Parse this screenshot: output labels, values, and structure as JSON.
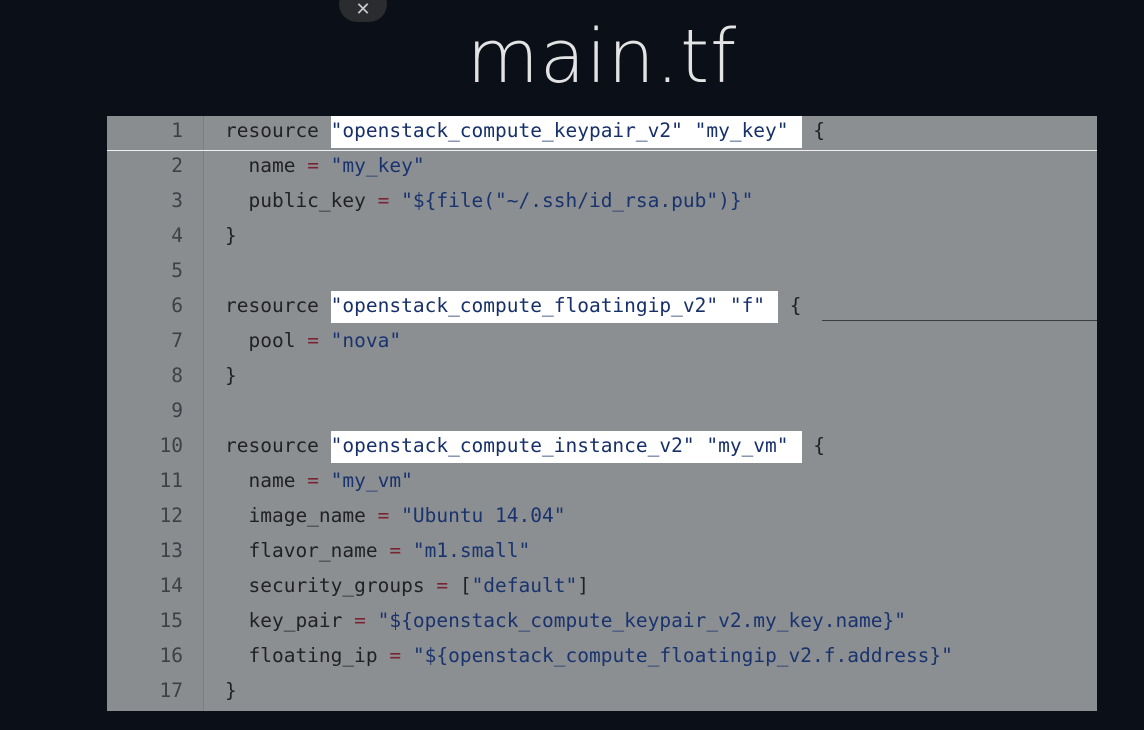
{
  "window": {
    "close_label": "✕"
  },
  "slide": {
    "title": "main.tf"
  },
  "code": {
    "lines": [
      {
        "n": "1",
        "parts": [
          [
            "kw",
            "resource "
          ],
          [
            "hl",
            "\"openstack_compute_keypair_v2\" \"my_key\""
          ],
          [
            "kw",
            " {"
          ]
        ]
      },
      {
        "n": "2",
        "parts": [
          [
            "kw",
            "  name "
          ],
          [
            "op",
            "="
          ],
          [
            "str",
            " \"my_key\""
          ]
        ]
      },
      {
        "n": "3",
        "parts": [
          [
            "kw",
            "  public_key "
          ],
          [
            "op",
            "="
          ],
          [
            "str",
            " \"${file(\"~/.ssh/id_rsa.pub\")}\""
          ]
        ]
      },
      {
        "n": "4",
        "parts": [
          [
            "kw",
            "}"
          ]
        ]
      },
      {
        "n": "5",
        "parts": []
      },
      {
        "n": "6",
        "parts": [
          [
            "kw",
            "resource "
          ],
          [
            "hl",
            "\"openstack_compute_floatingip_v2\" \"f\""
          ],
          [
            "kw",
            " {"
          ]
        ]
      },
      {
        "n": "7",
        "parts": [
          [
            "kw",
            "  pool "
          ],
          [
            "op",
            "="
          ],
          [
            "str",
            " \"nova\""
          ]
        ]
      },
      {
        "n": "8",
        "parts": [
          [
            "kw",
            "}"
          ]
        ]
      },
      {
        "n": "9",
        "parts": []
      },
      {
        "n": "10",
        "parts": [
          [
            "kw",
            "resource "
          ],
          [
            "hl",
            "\"openstack_compute_instance_v2\" \"my_vm\""
          ],
          [
            "kw",
            " {"
          ]
        ]
      },
      {
        "n": "11",
        "parts": [
          [
            "kw",
            "  name "
          ],
          [
            "op",
            "="
          ],
          [
            "str",
            " \"my_vm\""
          ]
        ]
      },
      {
        "n": "12",
        "parts": [
          [
            "kw",
            "  image_name "
          ],
          [
            "op",
            "="
          ],
          [
            "str",
            " \"Ubuntu 14.04\""
          ]
        ]
      },
      {
        "n": "13",
        "parts": [
          [
            "kw",
            "  flavor_name "
          ],
          [
            "op",
            "="
          ],
          [
            "str",
            " \"m1.small\""
          ]
        ]
      },
      {
        "n": "14",
        "parts": [
          [
            "kw",
            "  security_groups "
          ],
          [
            "op",
            "="
          ],
          [
            "kw",
            " ["
          ],
          [
            "str",
            "\"default\""
          ],
          [
            "kw",
            "]"
          ]
        ]
      },
      {
        "n": "15",
        "parts": [
          [
            "kw",
            "  key_pair "
          ],
          [
            "op",
            "="
          ],
          [
            "str",
            " \"${openstack_compute_keypair_v2.my_key.name}\""
          ]
        ]
      },
      {
        "n": "16",
        "parts": [
          [
            "kw",
            "  floating_ip "
          ],
          [
            "op",
            "="
          ],
          [
            "str",
            " \"${openstack_compute_floatingip_v2.f.address}\""
          ]
        ]
      },
      {
        "n": "17",
        "parts": [
          [
            "kw",
            "}"
          ]
        ]
      }
    ]
  }
}
